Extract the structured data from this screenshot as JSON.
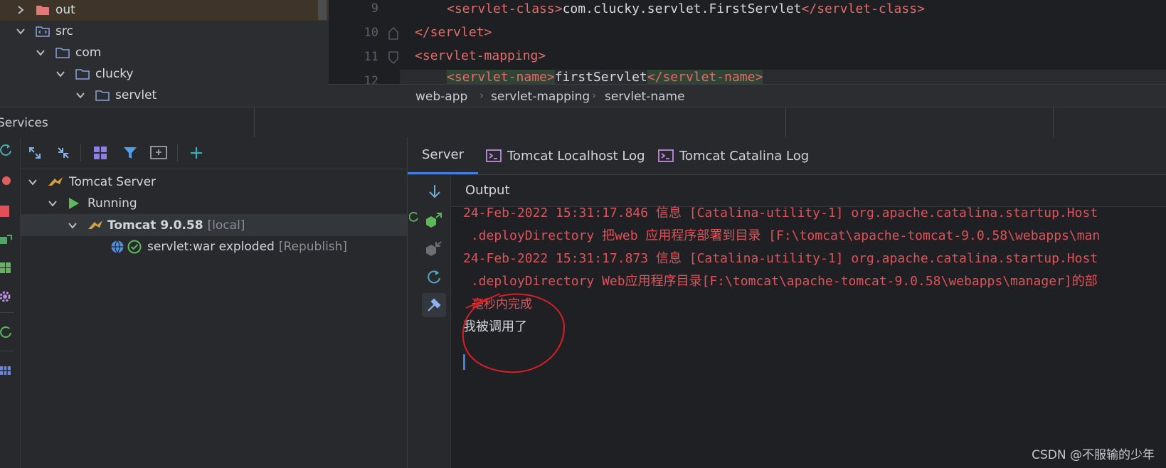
{
  "project_tree": [
    {
      "label": "out",
      "expanded": false,
      "icon": "folder-excluded-icon"
    },
    {
      "label": "src",
      "expanded": true,
      "icon": "source-folder-icon"
    },
    {
      "label": "com",
      "expanded": true,
      "icon": "folder-icon"
    },
    {
      "label": "clucky",
      "expanded": true,
      "icon": "folder-icon"
    },
    {
      "label": "servlet",
      "expanded": true,
      "icon": "folder-icon"
    }
  ],
  "editor": {
    "lines": [
      {
        "num": "9",
        "open": "<servlet-class>",
        "text": "com.clucky.servlet.FirstServlet",
        "close": "</servlet-class>"
      },
      {
        "num": "10",
        "open": "</servlet>",
        "text": "",
        "close": ""
      },
      {
        "num": "11",
        "open": "<servlet-mapping>",
        "text": "",
        "close": ""
      },
      {
        "num": "12",
        "open": "<servlet-name>",
        "text": "firstServlet",
        "close": "</servlet-name>"
      }
    ]
  },
  "breadcrumbs": [
    "web-app",
    "servlet-mapping",
    "servlet-name"
  ],
  "services": {
    "title": "Services",
    "tree": {
      "server": "Tomcat Server",
      "state": "Running",
      "instance": "Tomcat 9.0.58",
      "instance_tag": "[local]",
      "artifact": "servlet:war exploded",
      "artifact_tag": "[Republish]"
    }
  },
  "tabs": [
    "Server",
    "Tomcat Localhost Log",
    "Tomcat Catalina Log"
  ],
  "output": {
    "label": "Output",
    "lines": [
      "24-Feb-2022 15:31:17.846 信息 [Catalina-utility-1] org.apache.catalina.startup.Host",
      " .deployDirectory 把web 应用程序部署到目录 [F:\\tomcat\\apache-tomcat-9.0.58\\webapps\\man",
      "24-Feb-2022 15:31:17.873 信息 [Catalina-utility-1] org.apache.catalina.startup.Host",
      " .deployDirectory Web应用程序目录[F:\\tomcat\\apache-tomcat-9.0.58\\webapps\\manager]的部",
      "毫秒内完成"
    ],
    "printed": "我被调用了"
  },
  "watermark": "CSDN @不服输的少年",
  "colors": {
    "accent": "#3d7ee0",
    "error_text": "#e0525a",
    "xml_tag": "#e56a6a",
    "annotation": "#d91e26"
  }
}
